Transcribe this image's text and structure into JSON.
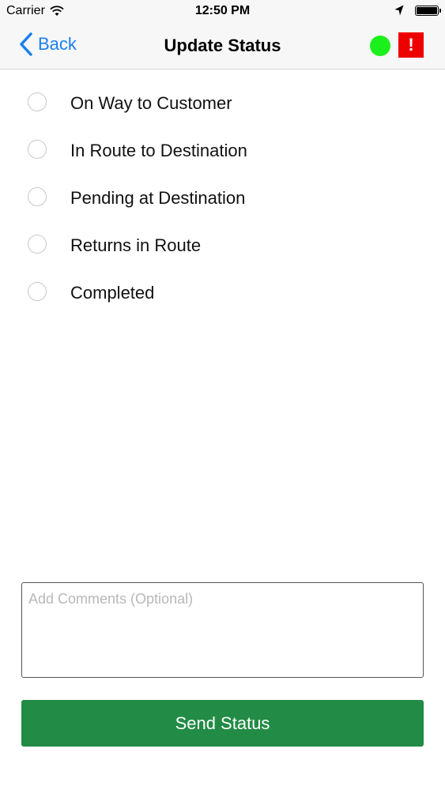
{
  "status_bar": {
    "carrier": "Carrier",
    "time": "12:50 PM",
    "icons": [
      "wifi-icon",
      "location-arrow-icon",
      "battery-icon"
    ]
  },
  "nav": {
    "back_label": "Back",
    "title": "Update Status",
    "online_indicator_color": "#1cf01c",
    "alert_label": "!",
    "alert_color": "#ee0000",
    "accent_color": "#1a7ff0"
  },
  "status_options": [
    {
      "label": "On Way to Customer",
      "selected": false
    },
    {
      "label": "In Route to Destination",
      "selected": false
    },
    {
      "label": "Pending at Destination",
      "selected": false
    },
    {
      "label": "Returns in Route",
      "selected": false
    },
    {
      "label": "Completed",
      "selected": false
    }
  ],
  "comments": {
    "placeholder": "Add Comments (Optional)",
    "value": ""
  },
  "send_button": {
    "label": "Send Status",
    "color": "#228b45"
  }
}
